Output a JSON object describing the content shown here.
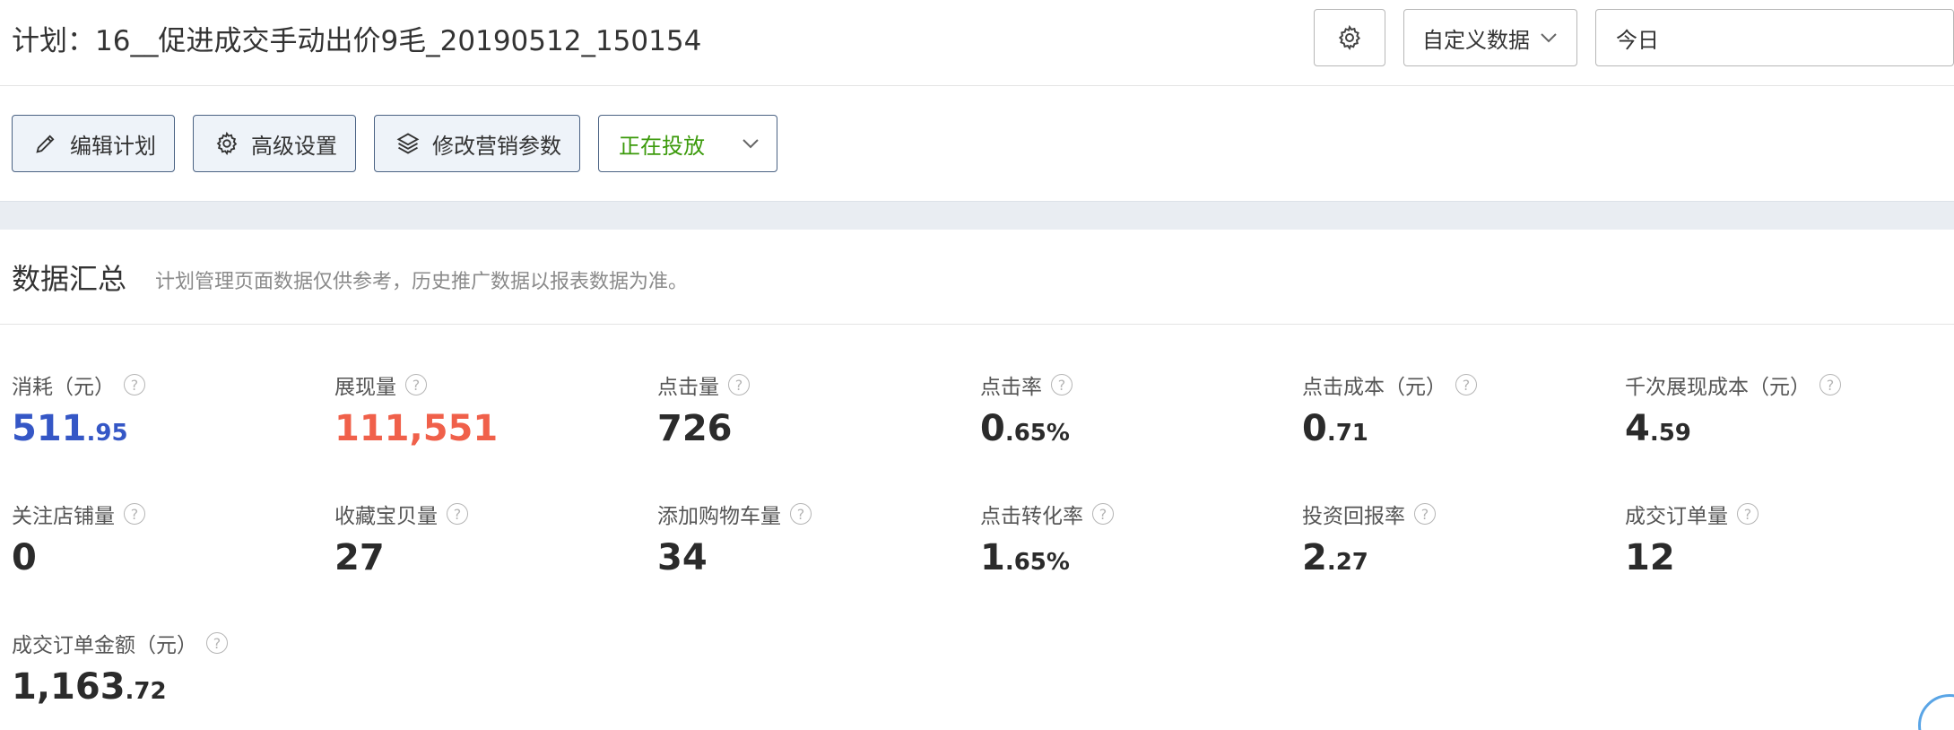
{
  "header": {
    "plan_title": "计划：16__促进成交手动出价9毛_20190512_150154",
    "custom_data_label": "自定义数据",
    "date_label": "今日"
  },
  "toolbar": {
    "edit_plan": "编辑计划",
    "advanced_settings": "高级设置",
    "modify_marketing": "修改营销参数",
    "status": "正在投放"
  },
  "summary": {
    "title": "数据汇总",
    "note": "计划管理页面数据仅供参考，历史推广数据以报表数据为准。"
  },
  "metrics": [
    {
      "label": "消耗（元）",
      "int": "511",
      "dec": ".95",
      "color": "#3557c6"
    },
    {
      "label": "展现量",
      "int": "111,551",
      "dec": "",
      "color": "#f0604a"
    },
    {
      "label": "点击量",
      "int": "726",
      "dec": ""
    },
    {
      "label": "点击率",
      "int": "0",
      "dec": ".65%"
    },
    {
      "label": "点击成本（元）",
      "int": "0",
      "dec": ".71"
    },
    {
      "label": "千次展现成本（元）",
      "int": "4",
      "dec": ".59"
    },
    {
      "label": "关注店铺量",
      "int": "0",
      "dec": ""
    },
    {
      "label": "收藏宝贝量",
      "int": "27",
      "dec": ""
    },
    {
      "label": "添加购物车量",
      "int": "34",
      "dec": ""
    },
    {
      "label": "点击转化率",
      "int": "1",
      "dec": ".65%"
    },
    {
      "label": "投资回报率",
      "int": "2",
      "dec": ".27"
    },
    {
      "label": "成交订单量",
      "int": "12",
      "dec": ""
    },
    {
      "label": "成交订单金额（元）",
      "int": "1,163",
      "dec": ".72"
    }
  ],
  "icons": {
    "settings": "gear-icon",
    "edit": "pencil-icon",
    "advanced": "gear-icon",
    "marketing": "layers-icon",
    "dropdown": "chevron-down-icon",
    "help": "help-icon"
  }
}
